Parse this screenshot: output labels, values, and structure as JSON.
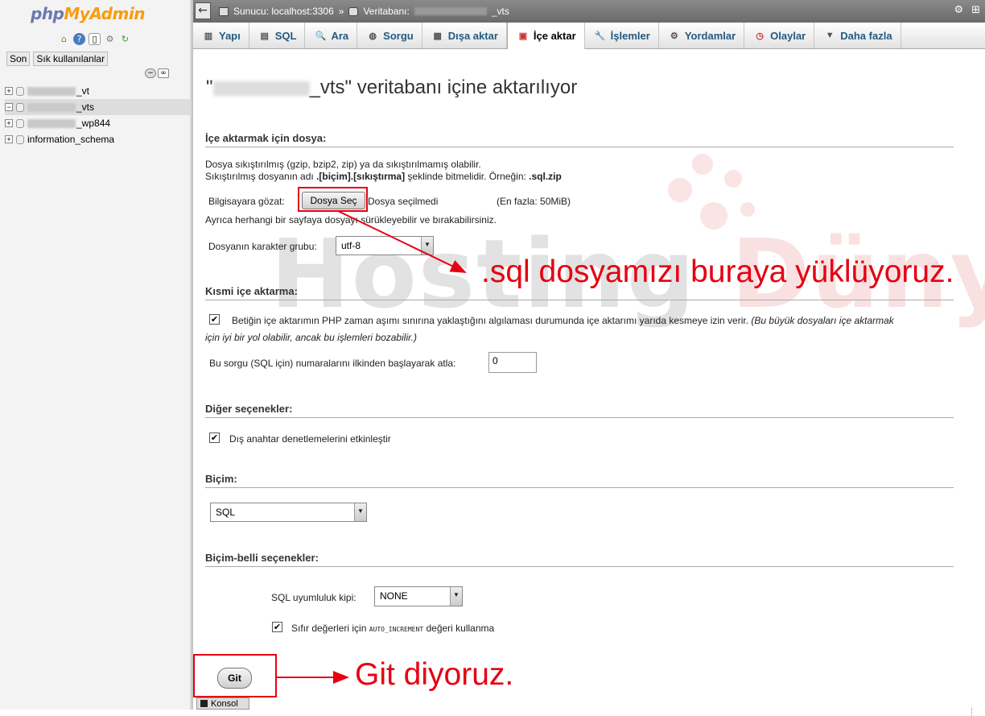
{
  "app": {
    "logo_part1": "php",
    "logo_part2": "MyAdmin"
  },
  "sidebar": {
    "tabs": [
      "Son",
      "Sık kullanılanlar"
    ],
    "databases": [
      {
        "suffix": "_vt",
        "blurred": true,
        "active": false
      },
      {
        "suffix": "_vts",
        "blurred": true,
        "active": true
      },
      {
        "suffix": "_wp844",
        "blurred": true,
        "active": false
      },
      {
        "suffix": "information_schema",
        "blurred": false,
        "active": false
      }
    ],
    "icons": [
      "home-icon",
      "help-icon",
      "docs-icon",
      "settings-icon",
      "reload-icon"
    ]
  },
  "breadcrumb": {
    "server_label": "Sunucu: localhost:3306",
    "separator": "»",
    "db_label": "Veritabanı:",
    "db_suffix": "_vts"
  },
  "tabs": [
    {
      "label": "Yapı",
      "icon": "structure-icon"
    },
    {
      "label": "SQL",
      "icon": "sql-icon"
    },
    {
      "label": "Ara",
      "icon": "search-icon"
    },
    {
      "label": "Sorgu",
      "icon": "query-icon"
    },
    {
      "label": "Dışa aktar",
      "icon": "export-icon"
    },
    {
      "label": "İçe aktar",
      "icon": "import-icon",
      "active": true
    },
    {
      "label": "İşlemler",
      "icon": "operations-icon"
    },
    {
      "label": "Yordamlar",
      "icon": "routines-icon"
    },
    {
      "label": "Olaylar",
      "icon": "events-icon"
    },
    {
      "label": "Daha fazla",
      "icon": "more-icon"
    }
  ],
  "page": {
    "title_prefix": "\"",
    "title_suffix": "_vts\" veritabanı içine aktarılıyor"
  },
  "file_section": {
    "heading": "İçe aktarmak için dosya:",
    "line1": "Dosya sıkıştırılmış (gzip, bzip2, zip) ya da sıkıştırılmamış olabilir.",
    "line2_pre": "Sıkıştırılmış dosyanın adı ",
    "line2_bold": ".[biçim].[sıkıştırma]",
    "line2_post": " şeklinde bitmelidir. Örneğin: ",
    "line2_example": ".sql.zip",
    "browse_label": "Bilgisayara gözat:",
    "choose_button": "Dosya Seç",
    "no_file": "Dosya seçilmedi",
    "max_size": "(En fazla: 50MiB)",
    "drag_hint": "Ayrıca herhangi bir sayfaya dosyayı sürükleyebilir ve bırakabilirsiniz.",
    "charset_label": "Dosyanın karakter grubu:",
    "charset_value": "utf-8"
  },
  "partial_section": {
    "heading": "Kısmi içe aktarma:",
    "allow_interrupt": "Betiğin içe aktarımın PHP zaman aşımı sınırına yaklaştığını algılaması durumunda içe aktarımı yarıda kesmeye izin verir.",
    "allow_interrupt_note_1": "(Bu büyük dosyaları içe aktarmak",
    "allow_interrupt_note_2": "için iyi bir yol olabilir, ancak bu işlemleri bozabilir.)",
    "skip_label": "Bu sorgu (SQL için) numaralarını ilkinden başlayarak atla:",
    "skip_value": "0"
  },
  "other_section": {
    "heading": "Diğer seçenekler:",
    "fk_checks": "Dış anahtar denetlemelerini etkinleştir"
  },
  "format_section": {
    "heading": "Biçim:",
    "format_value": "SQL"
  },
  "format_options": {
    "heading": "Biçim-belli seçenekler:",
    "compat_label": "SQL uyumluluk kipi:",
    "compat_value": "NONE",
    "zero_pre": "Sıfır değerleri için ",
    "zero_code": "AUTO_INCREMENT",
    "zero_post": " değeri kullanma"
  },
  "submit": {
    "label": "Git"
  },
  "console": {
    "label": "Konsol"
  },
  "annotations": {
    "upload": ".sql dosyamızı buraya yüklüyoruz.",
    "go": "Git diyoruz."
  },
  "watermark": {
    "part1": "Hosting ",
    "part2": "Dünyam"
  },
  "colors": {
    "annotation_red": "#e60012",
    "tab_text": "#235a81",
    "logo_blue": "#6c78af",
    "logo_orange": "#f89c0e"
  }
}
